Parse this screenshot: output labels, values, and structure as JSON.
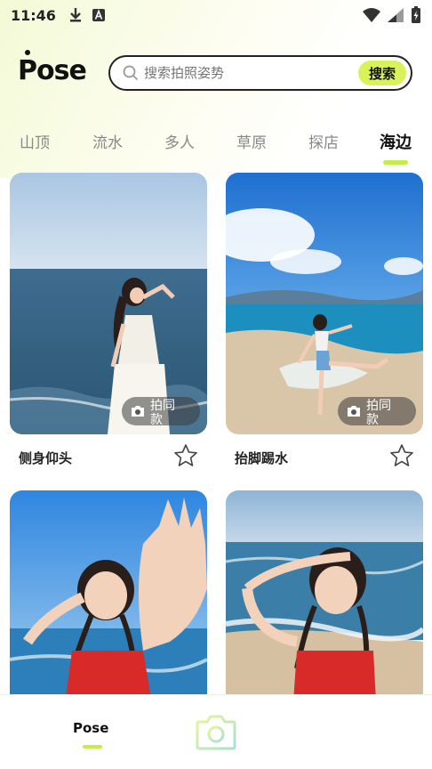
{
  "status_bar": {
    "time": "11:46",
    "left_icons": [
      "download-icon",
      "a-icon"
    ],
    "right_icons": [
      "wifi-icon",
      "signal-icon",
      "battery-icon"
    ]
  },
  "header": {
    "logo": "Pose",
    "search": {
      "placeholder": "搜索拍照姿势",
      "button_label": "搜索"
    }
  },
  "tabs": [
    {
      "label": "山顶",
      "active": false
    },
    {
      "label": "流水",
      "active": false
    },
    {
      "label": "多人",
      "active": false
    },
    {
      "label": "草原",
      "active": false
    },
    {
      "label": "探店",
      "active": false
    },
    {
      "label": "海边",
      "active": true
    }
  ],
  "cards": [
    {
      "title": "侧身仰头",
      "badge": "拍同款",
      "scene": "sea-pose-white-dress"
    },
    {
      "title": "抬脚踢水",
      "badge": "拍同款",
      "scene": "beach-kick-water"
    },
    {
      "title": "",
      "badge": "",
      "scene": "wave-hand-red-top"
    },
    {
      "title": "",
      "badge": "",
      "scene": "shade-eyes-red-top"
    }
  ],
  "bottom_nav": {
    "items": [
      {
        "label": "Pose",
        "active": true
      },
      {
        "label": "",
        "icon": "camera-icon",
        "active": false
      }
    ]
  },
  "colors": {
    "accent": "#c6ec4a",
    "search_button": "#d8f25a",
    "text_primary": "#111111",
    "text_secondary": "#888888"
  }
}
